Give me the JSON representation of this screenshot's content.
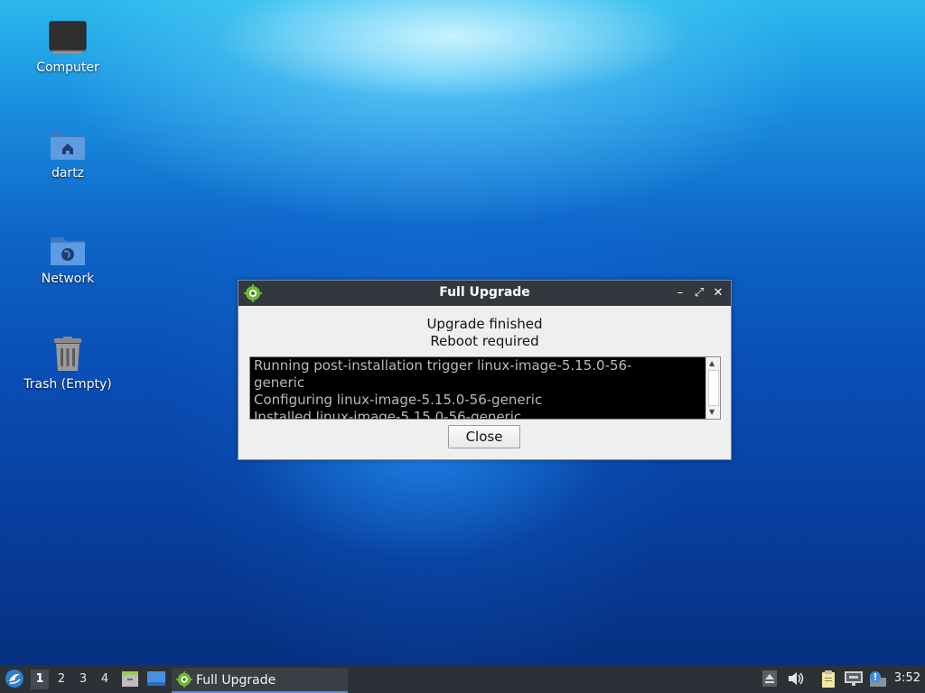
{
  "desktop": {
    "icons": [
      {
        "label": "Computer",
        "icon": "computer-icon"
      },
      {
        "label": "dartz",
        "icon": "home-folder-icon"
      },
      {
        "label": "Network",
        "icon": "network-folder-icon"
      },
      {
        "label": "Trash (Empty)",
        "icon": "trash-icon"
      }
    ]
  },
  "dialog": {
    "title": "Full Upgrade",
    "app_icon": "gear-icon",
    "message_line1": "Upgrade finished",
    "message_line2": "Reboot required",
    "log_lines": [
      "Running post-installation trigger linux-image-5.15.0-56-",
      "generic",
      "Configuring linux-image-5.15.0-56-generic",
      "Installed linux-image-5.15.0-56-generic"
    ],
    "close_button": "Close",
    "controls": {
      "minimize": "–",
      "maximize": "⤢",
      "close": "✕"
    }
  },
  "taskbar": {
    "menu_icon": "lubuntu-menu-icon",
    "workspaces": [
      "1",
      "2",
      "3",
      "4"
    ],
    "active_workspace": "1",
    "launchers": [
      "file-manager-icon",
      "show-desktop-icon"
    ],
    "task_label": "Full Upgrade",
    "tray_icons": [
      "eject-icon",
      "volume-icon",
      "clipboard-icon",
      "network-icon",
      "update-notifier-icon"
    ],
    "clock": "3:52"
  },
  "colors": {
    "titlebar": "#33383e",
    "taskbar": "#2c3137",
    "dialog_border": "#6b8bb8",
    "log_background": "#000000",
    "log_text": "#b9b9b9"
  }
}
